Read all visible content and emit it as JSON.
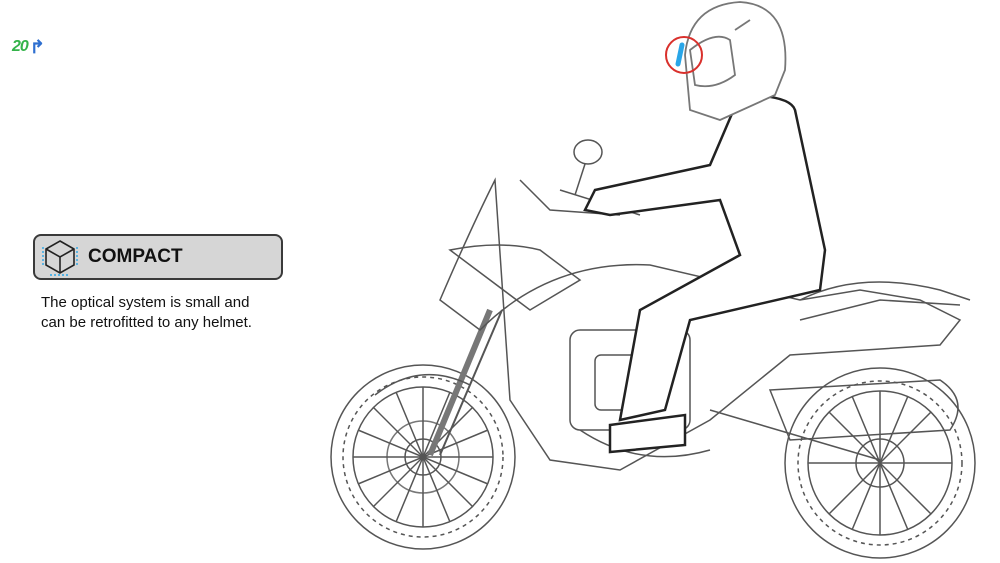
{
  "logo": {
    "text": "20",
    "icon": "turn-arrow-icon",
    "colors": {
      "text": "#34b34a",
      "arrow": "#2e6fd0"
    }
  },
  "feature": {
    "title": "COMPACT",
    "icon": "cube-icon",
    "description": "The optical system is small and can be retrofitted to any helmet."
  },
  "illustration": {
    "subject": "motorcycle-with-rider-icon",
    "highlight": {
      "icon": "helmet-optic-highlight",
      "ring_color": "#d9302c",
      "optic_color": "#29a6e8"
    }
  }
}
